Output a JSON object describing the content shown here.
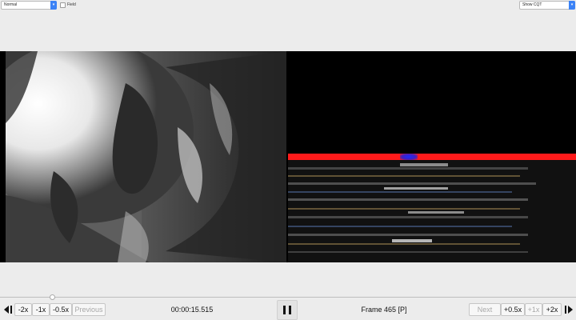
{
  "top": {
    "mode_select": "Normal",
    "field_label": "Field",
    "cqt_select": "Show CQT"
  },
  "controls": {
    "minus2": "-2x",
    "minus1": "-1x",
    "minus05": "-0.5x",
    "previous": "Previous",
    "timecode": "00:00:15.515",
    "frame": "Frame 465 [P]",
    "next": "Next",
    "plus05": "+0.5x",
    "plus1": "+1x",
    "plus2": "+2x"
  },
  "seek": {
    "position_fraction": 0.09
  },
  "colors": {
    "accent": "#3b82f6",
    "cqt_line": "#ff1a1a",
    "cqt_marker": "#1a2cff"
  },
  "icons": [
    "step-back-icon",
    "pause-icon",
    "step-forward-icon",
    "chevron-down-icon"
  ]
}
